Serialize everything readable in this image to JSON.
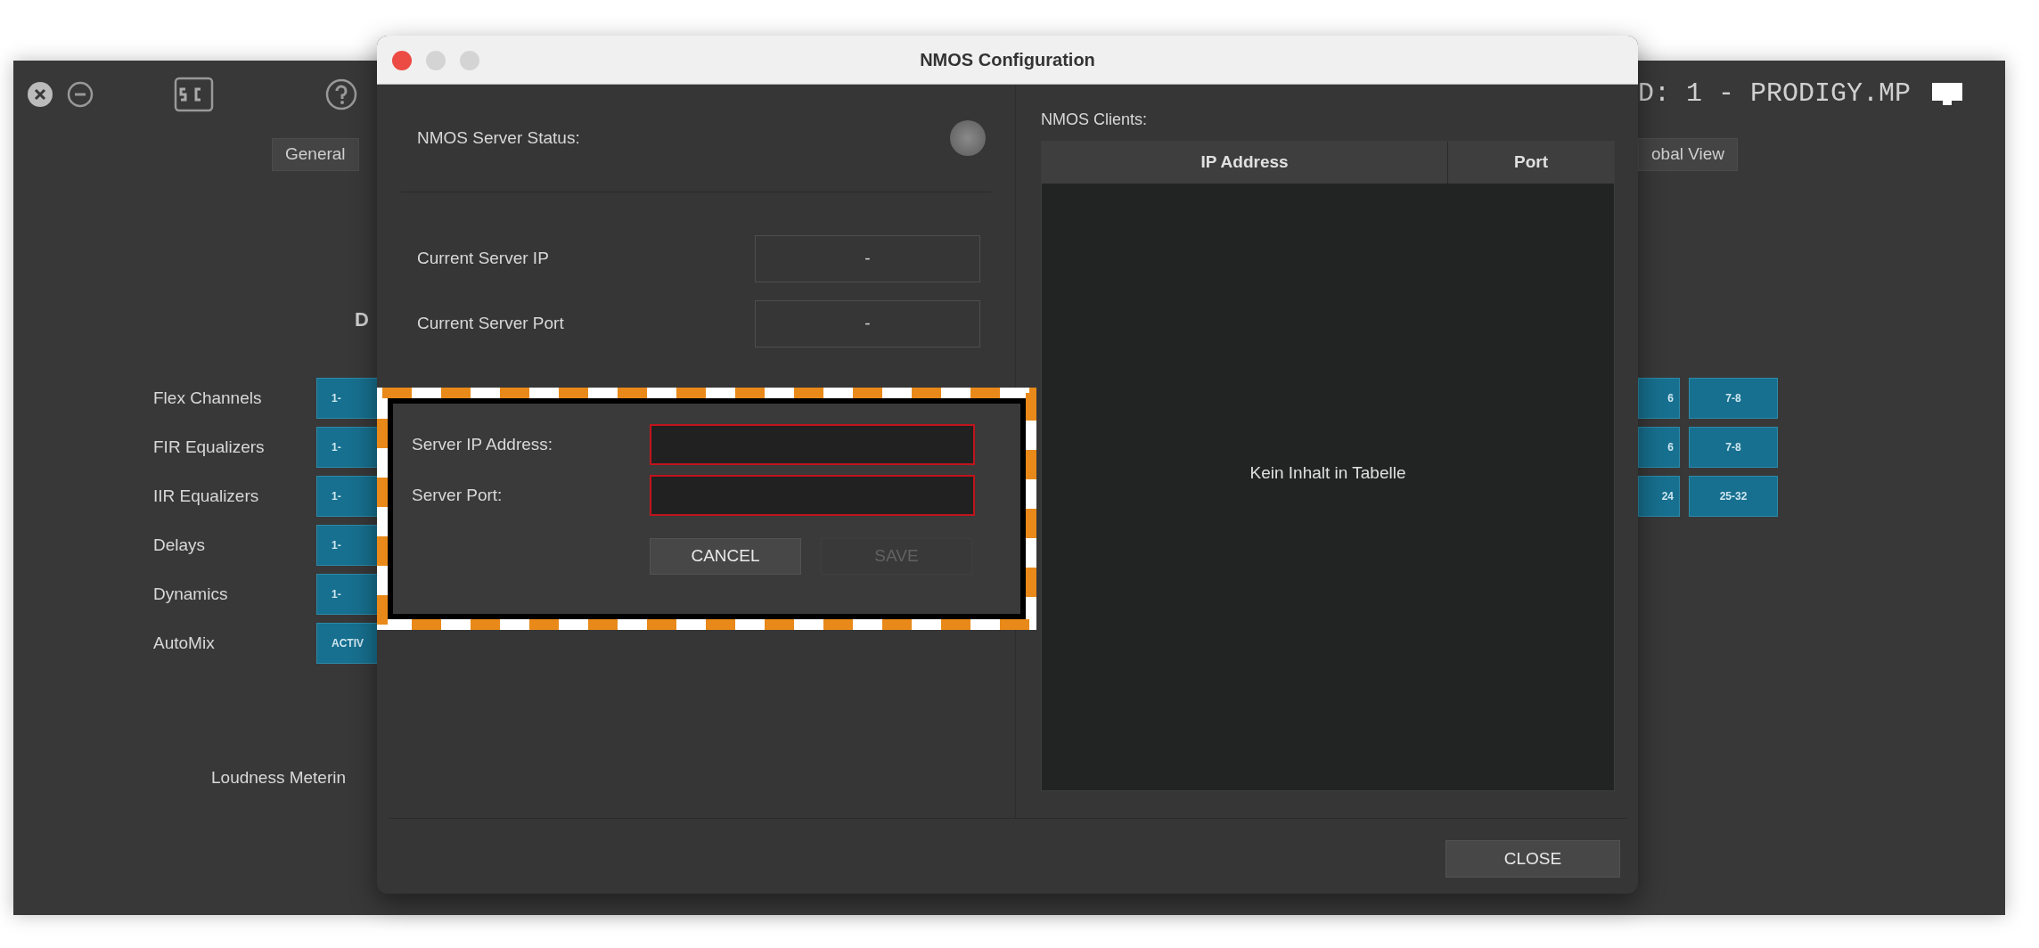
{
  "app": {
    "title": "D: 1 - PRODIGY.MP",
    "tabs": [
      {
        "label": "General"
      },
      {
        "label": "obal View"
      }
    ],
    "heading": "D",
    "rows": [
      {
        "label": "Flex Channels",
        "left_button": "1-",
        "right_buttons": [
          "6",
          "7-8"
        ]
      },
      {
        "label": "FIR Equalizers",
        "left_button": "1-",
        "right_buttons": [
          "6",
          "7-8"
        ]
      },
      {
        "label": "IIR Equalizers",
        "left_button": "1-",
        "right_buttons": [
          "24",
          "25-32"
        ]
      },
      {
        "label": "Delays",
        "left_button": "1-"
      },
      {
        "label": "Dynamics",
        "left_button": "1-"
      },
      {
        "label": "AutoMix",
        "left_button": "ACTIV"
      }
    ],
    "loudness_label": "Loudness Meterin"
  },
  "dialog": {
    "title": "NMOS Configuration",
    "server_status": {
      "label": "NMOS Server Status:",
      "on": false
    },
    "current": [
      {
        "label": "Current Server IP",
        "value": "-"
      },
      {
        "label": "Current Server Port",
        "value": "-"
      }
    ],
    "form": {
      "fields": [
        {
          "label": "Server IP Address:",
          "invalid": true
        },
        {
          "label": "Server Port:",
          "invalid": true
        }
      ],
      "buttons": [
        {
          "label": "CANCEL",
          "disabled": false
        },
        {
          "label": "SAVE",
          "disabled": true
        }
      ]
    },
    "clients": {
      "heading": "NMOS Clients:",
      "columns": [
        "IP Address",
        "Port"
      ],
      "empty_message": "Kein Inhalt in Tabelle"
    },
    "close_button": "CLOSE"
  }
}
